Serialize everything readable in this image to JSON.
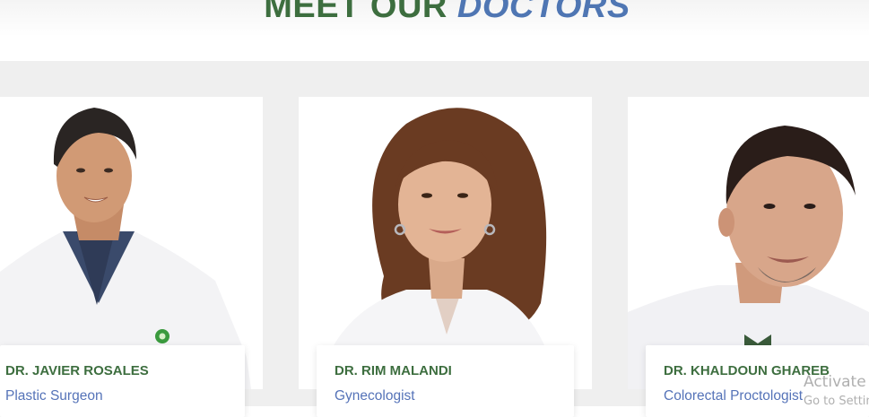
{
  "header": {
    "title_part1": "MEET OUR",
    "title_part2": "DOCTORS"
  },
  "doctors": [
    {
      "name": "DR. JAVIER ROSALES",
      "specialty": "Plastic Surgeon"
    },
    {
      "name": "DR. RIM MALANDI",
      "specialty": "Gynecologist"
    },
    {
      "name": "DR. KHALDOUN GHAREB",
      "specialty": "Colorectal Proctologist"
    }
  ],
  "watermark": {
    "line1": "Activate",
    "line2": "Go to Settin"
  }
}
